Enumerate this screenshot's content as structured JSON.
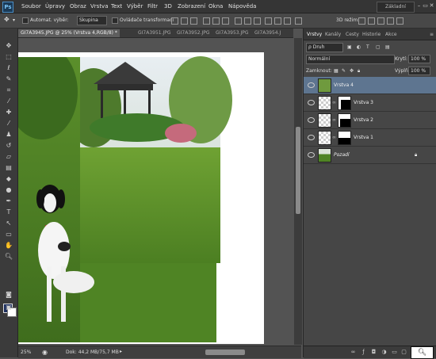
{
  "app": {
    "logo": "Ps",
    "workspace": "Základní",
    "window_controls": [
      "–",
      "▭",
      "✕"
    ]
  },
  "menu": [
    "Soubor",
    "Úpravy",
    "Obraz",
    "Vrstva",
    "Text",
    "Výběr",
    "Filtr",
    "3D",
    "Zobrazení",
    "Okna",
    "Nápověda"
  ],
  "options": {
    "auto_select_label": "Automat. výběr:",
    "auto_select_value": "Skupina",
    "transform_label": "Ovládače transformací",
    "mode_3d_label": "3D režim:"
  },
  "doc_tabs": [
    "GI7A3945.JPG @ 25% (Vrstva 4,RGB/8) *",
    "GI7A3951.JPG",
    "GI7A3952.JPG",
    "GI7A3953.JPG",
    "GI7A3954.J"
  ],
  "status": {
    "zoom": "25%",
    "doc_size": "Dok: 44,2 MB/75,7 MB",
    "arrow": "▸"
  },
  "panel": {
    "tabs": [
      "Vrstvy",
      "Kanály",
      "Cesty",
      "Historie",
      "Akce"
    ],
    "kind": "ρ Druh",
    "blend_mode": "Normální",
    "opacity_label": "Krytí:",
    "opacity_value": "100 %",
    "lock_label": "Zamknout:",
    "fill_label": "Výplň:",
    "fill_value": "100 %",
    "layers": [
      {
        "name": "Vrstva 4",
        "selected": true
      },
      {
        "name": "Vrstva 3",
        "selected": false
      },
      {
        "name": "Vrstva 2",
        "selected": false
      },
      {
        "name": "Vrstva 1",
        "selected": false
      },
      {
        "name": "Pozadí",
        "selected": false
      }
    ]
  },
  "colors": {
    "foreground": "#1d2f5e",
    "background": "#ffffff",
    "selected_layer": "#5e7590"
  }
}
